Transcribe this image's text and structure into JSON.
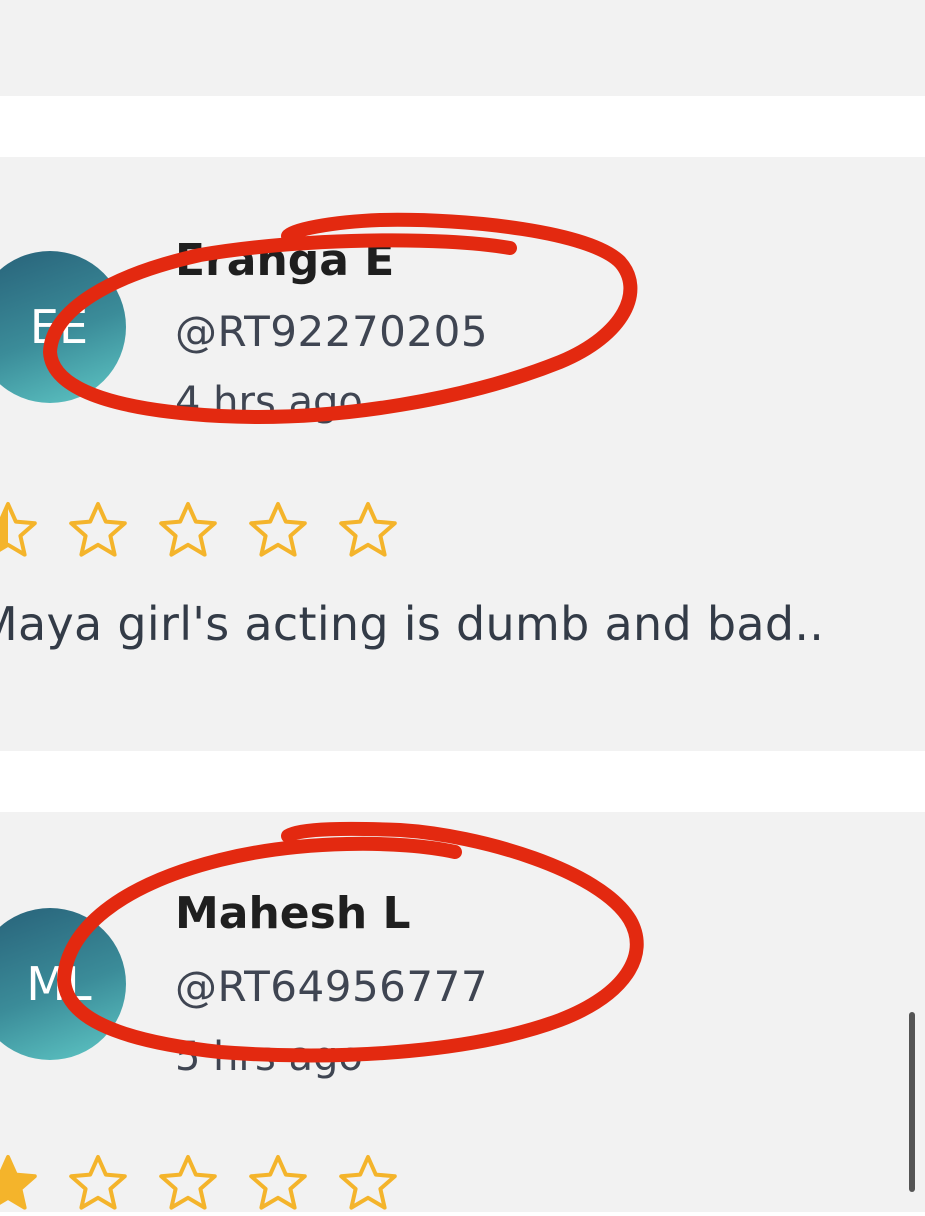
{
  "colors": {
    "card_background": "#f2f2f2",
    "separator": "#ffffff",
    "star_color": "#f4b42b",
    "annotation_red": "#e32910",
    "avatar_gradient": [
      "#276078",
      "#5fc8c6"
    ]
  },
  "reviews": [
    {
      "avatar_initials": "EE",
      "name": "Eranga E",
      "handle": "@RT92270205",
      "time_ago": "4 hrs ago",
      "rating": 0.5,
      "max_rating": 5,
      "text": "Maya girl's acting is dumb and bad.."
    },
    {
      "avatar_initials": "ML",
      "name": "Mahesh L",
      "handle": "@RT64956777",
      "time_ago": "5 hrs ago",
      "rating": 1,
      "max_rating": 5
    }
  ],
  "icons": {
    "star_full": "star-icon",
    "star_half": "star-half-icon",
    "star_empty": "star-outline-icon"
  }
}
